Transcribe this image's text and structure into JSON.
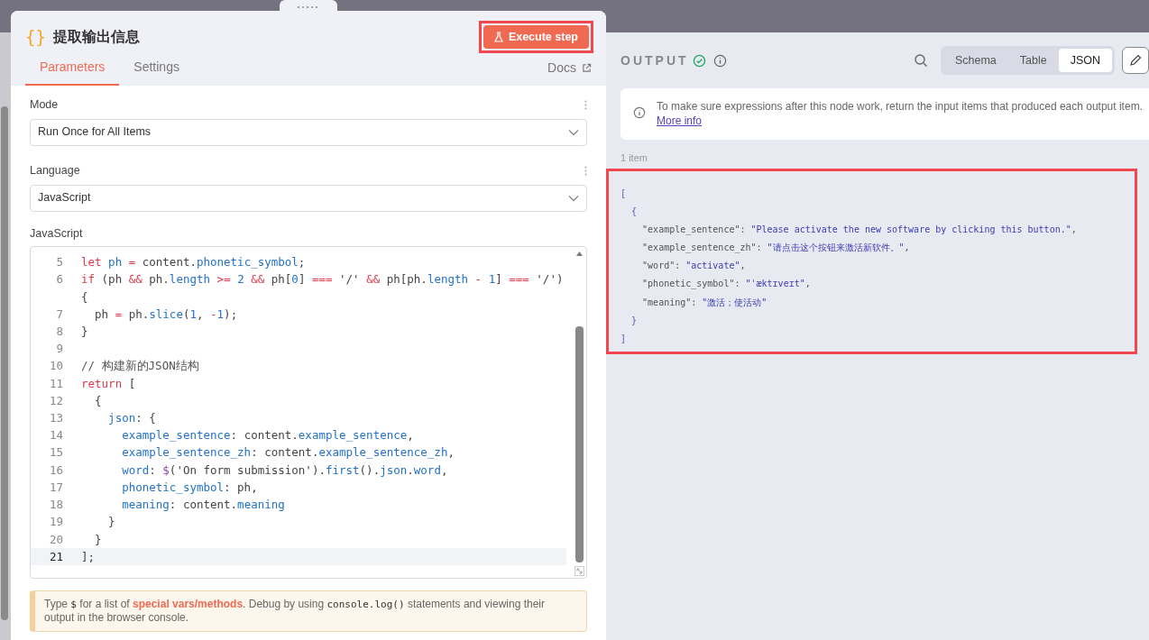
{
  "node": {
    "icon": "{}",
    "title": "提取输出信息",
    "execute_button": "Execute step",
    "tabs": [
      {
        "label": "Parameters",
        "selected": true
      },
      {
        "label": "Settings",
        "selected": false
      }
    ],
    "docs_link": "Docs"
  },
  "parameters": {
    "mode": {
      "label": "Mode",
      "value": "Run Once for All Items"
    },
    "language": {
      "label": "Language",
      "value": "JavaScript"
    },
    "code": {
      "label": "JavaScript",
      "lines": [
        {
          "number": "5",
          "active": false,
          "tokens": [
            {
              "kind": "keyword",
              "text": "let "
            },
            {
              "kind": "property",
              "text": "ph"
            },
            {
              "kind": "keyword",
              "text": " = "
            },
            {
              "kind": "plain",
              "text": "content."
            },
            {
              "kind": "property",
              "text": "phonetic_symbol"
            },
            {
              "kind": "plain",
              "text": ";"
            }
          ]
        },
        {
          "number": "6",
          "active": false,
          "tokens": [
            {
              "kind": "keyword",
              "text": "if"
            },
            {
              "kind": "plain",
              "text": " (ph "
            },
            {
              "kind": "keyword",
              "text": "&& "
            },
            {
              "kind": "plain",
              "text": "ph."
            },
            {
              "kind": "property",
              "text": "length"
            },
            {
              "kind": "keyword",
              "text": " >= "
            },
            {
              "kind": "number",
              "text": "2"
            },
            {
              "kind": "keyword",
              "text": " && "
            },
            {
              "kind": "plain",
              "text": "ph["
            },
            {
              "kind": "number",
              "text": "0"
            },
            {
              "kind": "plain",
              "text": "] "
            },
            {
              "kind": "keyword",
              "text": "=== "
            },
            {
              "kind": "plain",
              "text": "'/' "
            },
            {
              "kind": "keyword",
              "text": "&& "
            },
            {
              "kind": "plain",
              "text": "ph[ph."
            },
            {
              "kind": "property",
              "text": "length"
            },
            {
              "kind": "keyword",
              "text": " - "
            },
            {
              "kind": "number",
              "text": "1"
            },
            {
              "kind": "plain",
              "text": "] "
            },
            {
              "kind": "keyword",
              "text": "=== "
            },
            {
              "kind": "plain",
              "text": "'/') {"
            }
          ]
        },
        {
          "number": "7",
          "active": false,
          "tokens": [
            {
              "kind": "plain",
              "text": "  ph "
            },
            {
              "kind": "keyword",
              "text": "= "
            },
            {
              "kind": "plain",
              "text": "ph."
            },
            {
              "kind": "property",
              "text": "slice"
            },
            {
              "kind": "plain",
              "text": "("
            },
            {
              "kind": "number",
              "text": "1"
            },
            {
              "kind": "plain",
              "text": ", "
            },
            {
              "kind": "keyword",
              "text": "-"
            },
            {
              "kind": "number",
              "text": "1"
            },
            {
              "kind": "plain",
              "text": ");"
            }
          ]
        },
        {
          "number": "8",
          "active": false,
          "tokens": [
            {
              "kind": "plain",
              "text": "}"
            }
          ]
        },
        {
          "number": "9",
          "active": false
        },
        {
          "number": "10",
          "active": false,
          "tokens": [
            {
              "kind": "comment",
              "text": "// 构建新的JSON结构"
            }
          ]
        },
        {
          "number": "11",
          "active": false,
          "tokens": [
            {
              "kind": "keyword",
              "text": "return"
            },
            {
              "kind": "plain",
              "text": " ["
            }
          ]
        },
        {
          "number": "12",
          "active": false,
          "tokens": [
            {
              "kind": "plain",
              "text": "  {"
            }
          ]
        },
        {
          "number": "13",
          "active": false,
          "tokens": [
            {
              "kind": "property",
              "text": "    json"
            },
            {
              "kind": "plain",
              "text": ": {"
            }
          ]
        },
        {
          "number": "14",
          "active": false,
          "tokens": [
            {
              "kind": "property",
              "text": "      example_sentence"
            },
            {
              "kind": "plain",
              "text": ": content."
            },
            {
              "kind": "property",
              "text": "example_sentence"
            },
            {
              "kind": "plain",
              "text": ","
            }
          ]
        },
        {
          "number": "15",
          "active": false,
          "tokens": [
            {
              "kind": "property",
              "text": "      example_sentence_zh"
            },
            {
              "kind": "plain",
              "text": ": content."
            },
            {
              "kind": "property",
              "text": "example_sentence_zh"
            },
            {
              "kind": "plain",
              "text": ","
            }
          ]
        },
        {
          "number": "16",
          "active": false,
          "tokens": [
            {
              "kind": "property",
              "text": "      word"
            },
            {
              "kind": "plain",
              "text": ": "
            },
            {
              "kind": "function",
              "text": "$"
            },
            {
              "kind": "plain",
              "text": "('On form submission')."
            },
            {
              "kind": "property",
              "text": "first"
            },
            {
              "kind": "plain",
              "text": "()."
            },
            {
              "kind": "property",
              "text": "json"
            },
            {
              "kind": "plain",
              "text": "."
            },
            {
              "kind": "property",
              "text": "word"
            },
            {
              "kind": "plain",
              "text": ","
            }
          ]
        },
        {
          "number": "17",
          "active": false,
          "tokens": [
            {
              "kind": "property",
              "text": "      phonetic_symbol"
            },
            {
              "kind": "plain",
              "text": ": ph,"
            }
          ]
        },
        {
          "number": "18",
          "active": false,
          "tokens": [
            {
              "kind": "property",
              "text": "      meaning"
            },
            {
              "kind": "plain",
              "text": ": content."
            },
            {
              "kind": "property",
              "text": "meaning"
            }
          ]
        },
        {
          "number": "19",
          "active": false,
          "tokens": [
            {
              "kind": "plain",
              "text": "    }"
            }
          ]
        },
        {
          "number": "20",
          "active": false,
          "tokens": [
            {
              "kind": "plain",
              "text": "  }"
            }
          ]
        },
        {
          "number": "21",
          "active": true,
          "tokens": [
            {
              "kind": "plain",
              "text": "];"
            }
          ]
        }
      ]
    },
    "hint": [
      {
        "kind": "text",
        "text": "Type "
      },
      {
        "kind": "code",
        "text": "$"
      },
      {
        "kind": "text",
        "text": " for a list of "
      },
      {
        "kind": "link",
        "text": "special vars/methods"
      },
      {
        "kind": "text",
        "text": ". Debug by using "
      },
      {
        "kind": "code",
        "text": "console.log()"
      },
      {
        "kind": "text",
        "text": " statements and viewing their output in the browser console."
      }
    ]
  },
  "output": {
    "title": "OUTPUT",
    "views": [
      {
        "label": "Schema",
        "selected": false
      },
      {
        "label": "Table",
        "selected": false
      },
      {
        "label": "JSON",
        "selected": true
      }
    ],
    "notice": {
      "text": "To make sure expressions after this node work, return the input items that produced each output item.",
      "link": "More info"
    },
    "count": "1 item",
    "json_lines": [
      [
        {
          "kind": "punct",
          "text": "["
        }
      ],
      [
        {
          "kind": "punct",
          "text": "  {"
        }
      ],
      [
        {
          "kind": "key",
          "text": "    \"example_sentence\": "
        },
        {
          "kind": "string",
          "text": "\"Please activate the new software by clicking this button.\""
        },
        {
          "kind": "key",
          "text": ","
        }
      ],
      [
        {
          "kind": "key",
          "text": "    \"example_sentence_zh\": "
        },
        {
          "kind": "string",
          "text": "\"请点击这个按钮来激活新软件。\""
        },
        {
          "kind": "key",
          "text": ","
        }
      ],
      [
        {
          "kind": "key",
          "text": "    \"word\": "
        },
        {
          "kind": "string",
          "text": "\"activate\""
        },
        {
          "kind": "key",
          "text": ","
        }
      ],
      [
        {
          "kind": "key",
          "text": "    \"phonetic_symbol\": "
        },
        {
          "kind": "string",
          "text": "\"ˈæktɪveɪt\""
        },
        {
          "kind": "key",
          "text": ","
        }
      ],
      [
        {
          "kind": "key",
          "text": "    \"meaning\": "
        },
        {
          "kind": "string",
          "text": "\"激活；使活动\""
        }
      ],
      [
        {
          "kind": "punct",
          "text": "  }"
        }
      ],
      [
        {
          "kind": "punct",
          "text": "]"
        }
      ]
    ]
  }
}
